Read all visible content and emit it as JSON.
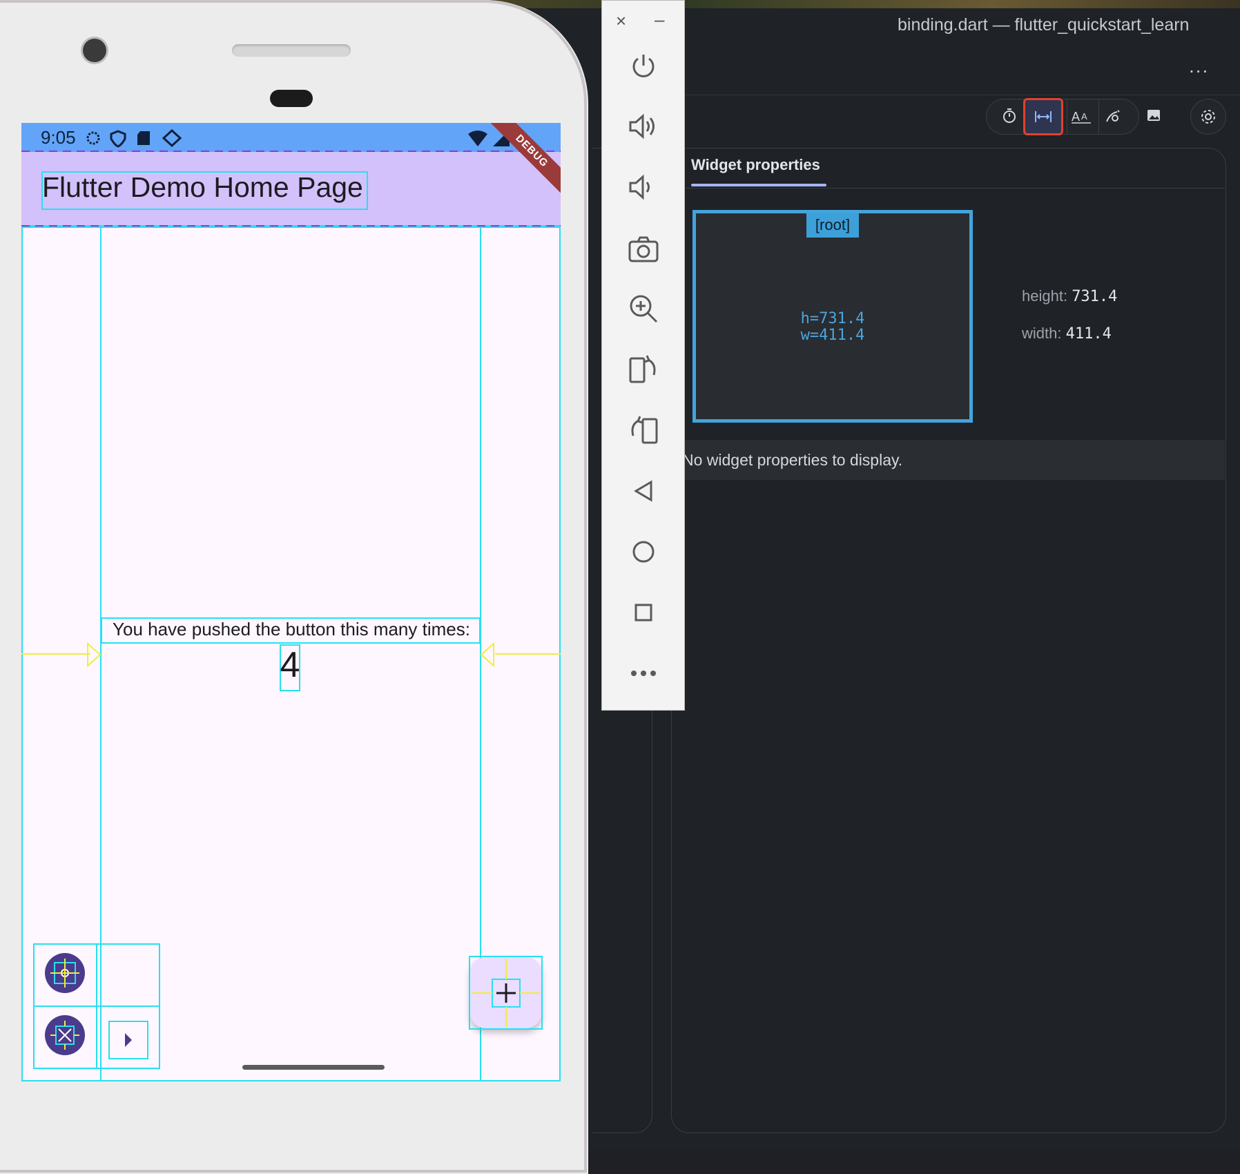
{
  "ide": {
    "title": "binding.dart — flutter_quickstart_learn",
    "more": "...",
    "toolbar": {
      "buttons": [
        {
          "name": "slow-animations",
          "icon": "timer-icon"
        },
        {
          "name": "layout-explorer",
          "icon": "width-arrows-icon",
          "selected": true
        },
        {
          "name": "text-baselines",
          "icon": "text-size-icon"
        },
        {
          "name": "repaint-rainbow",
          "icon": "paint-icon"
        },
        {
          "name": "oversized-images",
          "icon": "image-icon"
        }
      ],
      "settings_icon": "gear-icon"
    },
    "panel": {
      "tab_label": "Widget properties",
      "root_label": "[root]",
      "root_h": "h=731.4",
      "root_w": "w=411.4",
      "height_label": "height:",
      "height_value": "731.4",
      "width_label": "width:",
      "width_value": "411.4",
      "empty_message": "No widget properties to display."
    },
    "accent_color": "#42a5dc",
    "highlight_color": "#e0422c"
  },
  "emulator": {
    "close": "×",
    "minimize": "–",
    "controls": [
      {
        "name": "power",
        "icon": "power-icon"
      },
      {
        "name": "volume-up",
        "icon": "volume-up-icon"
      },
      {
        "name": "volume-down",
        "icon": "volume-down-icon"
      },
      {
        "name": "screenshot",
        "icon": "camera-icon"
      },
      {
        "name": "zoom",
        "icon": "zoom-in-icon"
      },
      {
        "name": "rotate-left",
        "icon": "rotate-left-icon"
      },
      {
        "name": "rotate-right",
        "icon": "rotate-right-icon"
      },
      {
        "name": "back",
        "icon": "back-icon"
      },
      {
        "name": "home",
        "icon": "home-icon"
      },
      {
        "name": "overview",
        "icon": "overview-icon"
      },
      {
        "name": "more",
        "icon": "more-icon"
      }
    ]
  },
  "phone": {
    "status_time": "9:05",
    "debug_banner": "DEBUG",
    "app_title": "Flutter Demo Home Page",
    "counter_label": "You have pushed the button this many times:",
    "counter_value": "4",
    "fab_icon": "plus-icon",
    "appbar_color": "#d3c1fb",
    "statusbar_color": "#62a4f8"
  }
}
